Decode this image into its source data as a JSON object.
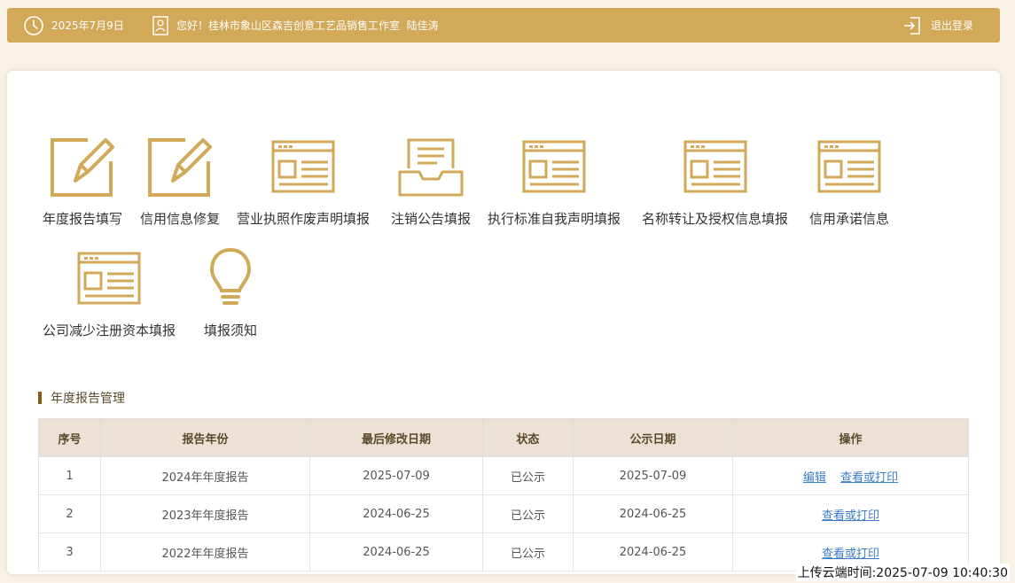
{
  "header": {
    "date": "2025年7月9日",
    "greeting": "您好！桂林市象山区森吉创意工艺品销售工作室  陆佳涛",
    "logout_label": "退出登录"
  },
  "colors": {
    "accent": "#d1a959",
    "link": "#3d7cc9",
    "table_header_bg": "#ebe1d4"
  },
  "tiles": [
    {
      "label": "年度报告填写",
      "icon": "edit-icon"
    },
    {
      "label": "信用信息修复",
      "icon": "edit-icon"
    },
    {
      "label": "营业执照作废声明填报",
      "icon": "form-icon"
    },
    {
      "label": "注销公告填报",
      "icon": "inbox-icon"
    },
    {
      "label": "执行标准自我声明填报",
      "icon": "form-icon"
    },
    {
      "label": "名称转让及授权信息填报",
      "icon": "form-icon"
    },
    {
      "label": "信用承诺信息",
      "icon": "form-icon"
    },
    {
      "label": "公司减少注册资本填报",
      "icon": "form-icon"
    },
    {
      "label": "填报须知",
      "icon": "lightbulb-icon"
    }
  ],
  "section_title": "年度报告管理",
  "table": {
    "headers": [
      "序号",
      "报告年份",
      "最后修改日期",
      "状态",
      "公示日期",
      "操作"
    ],
    "rows": [
      {
        "no": "1",
        "year": "2024年年度报告",
        "modified": "2025-07-09",
        "status": "已公示",
        "published": "2025-07-09",
        "actions": [
          "编辑",
          "查看或打印"
        ]
      },
      {
        "no": "2",
        "year": "2023年年度报告",
        "modified": "2024-06-25",
        "status": "已公示",
        "published": "2024-06-25",
        "actions": [
          "查看或打印"
        ]
      },
      {
        "no": "3",
        "year": "2022年年度报告",
        "modified": "2024-06-25",
        "status": "已公示",
        "published": "2024-06-25",
        "actions": [
          "查看或打印"
        ]
      }
    ]
  },
  "upload_time": "上传云端时间:2025-07-09 10:40:30"
}
